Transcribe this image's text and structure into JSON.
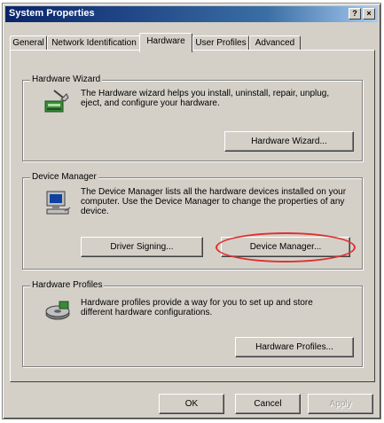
{
  "window": {
    "title": "System Properties",
    "help_button": "?",
    "close_button": "×"
  },
  "tabs": [
    {
      "label": "General",
      "active": false
    },
    {
      "label": "Network Identification",
      "active": false
    },
    {
      "label": "Hardware",
      "active": true
    },
    {
      "label": "User Profiles",
      "active": false
    },
    {
      "label": "Advanced",
      "active": false
    }
  ],
  "hardware_wizard": {
    "title": "Hardware Wizard",
    "description": "The Hardware wizard helps you install, uninstall, repair, unplug, eject, and configure your hardware.",
    "button": "Hardware Wizard..."
  },
  "device_manager": {
    "title": "Device Manager",
    "description": "The Device Manager lists all the hardware devices installed on your computer. Use the Device Manager to change the properties of any device.",
    "driver_signing_button": "Driver Signing...",
    "device_manager_button": "Device Manager..."
  },
  "hardware_profiles": {
    "title": "Hardware Profiles",
    "description": "Hardware profiles provide a way for you to set up and store different hardware configurations.",
    "button": "Hardware Profiles..."
  },
  "footer": {
    "ok": "OK",
    "cancel": "Cancel",
    "apply": "Apply"
  },
  "colors": {
    "titlebar_start": "#0a246a",
    "titlebar_end": "#a6caf0",
    "dialog_face": "#d4d0c8",
    "highlight_ring": "#e03030"
  }
}
